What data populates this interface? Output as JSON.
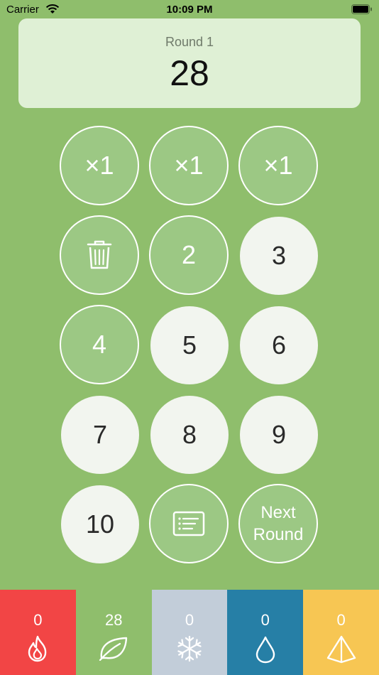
{
  "status": {
    "carrier": "Carrier",
    "time": "10:09 PM"
  },
  "score": {
    "round_label": "Round 1",
    "total": "28"
  },
  "keys": {
    "mult1": "×1",
    "mult2": "×1",
    "mult3": "×1",
    "n2": "2",
    "n3": "3",
    "n4": "4",
    "n5": "5",
    "n6": "6",
    "n7": "7",
    "n8": "8",
    "n9": "9",
    "n10": "10",
    "next_line1": "Next",
    "next_line2": "Round"
  },
  "tabs": [
    {
      "count": "0",
      "icon": "fire-icon",
      "color": "#f24545"
    },
    {
      "count": "28",
      "icon": "leaf-icon",
      "color": "#8fbe6c"
    },
    {
      "count": "0",
      "icon": "snowflake-icon",
      "color": "#c2cdd9"
    },
    {
      "count": "0",
      "icon": "water-drop-icon",
      "color": "#267fa6"
    },
    {
      "count": "0",
      "icon": "pyramid-icon",
      "color": "#f7c653"
    }
  ]
}
